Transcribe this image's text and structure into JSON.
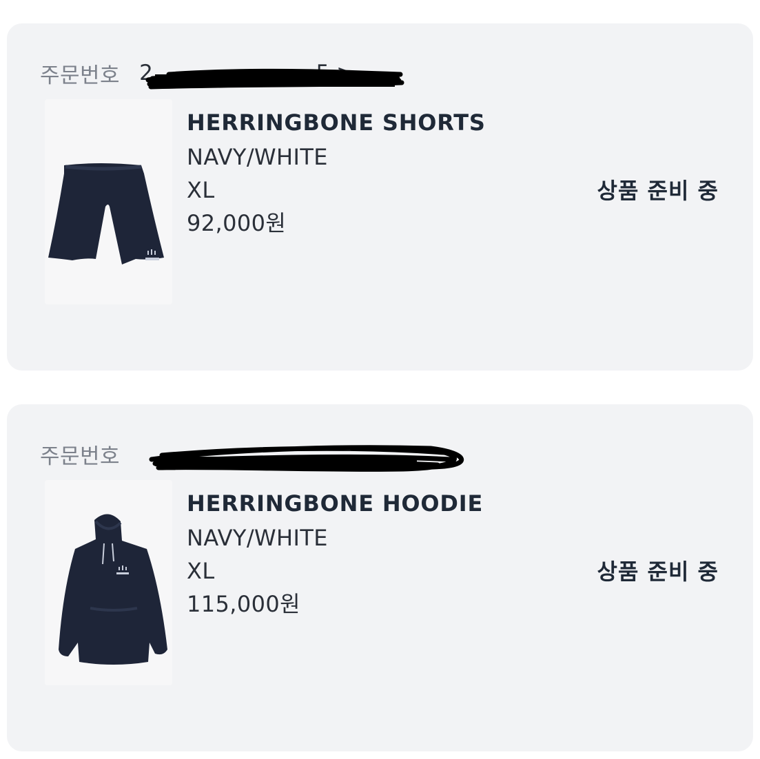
{
  "orders": [
    {
      "order_label": "주문번호",
      "order_number": "2            5 >",
      "product": {
        "name": "HERRINGBONE SHORTS",
        "color": "NAVY/WHITE",
        "size": "XL",
        "price": "92,000원",
        "thumbnail_icon": "navy-shorts-image"
      },
      "status": "상품 준비 중"
    },
    {
      "order_label": "주문번호",
      "order_number": "",
      "product": {
        "name": "HERRINGBONE HOODIE",
        "color": "NAVY/WHITE",
        "size": "XL",
        "price": "115,000원",
        "thumbnail_icon": "navy-hoodie-image"
      },
      "status": "상품 준비 중"
    }
  ],
  "colors": {
    "card_background": "#f2f3f5",
    "navy_product": "#1e2538",
    "text_primary": "#1f2937",
    "text_muted": "#7c818b"
  }
}
